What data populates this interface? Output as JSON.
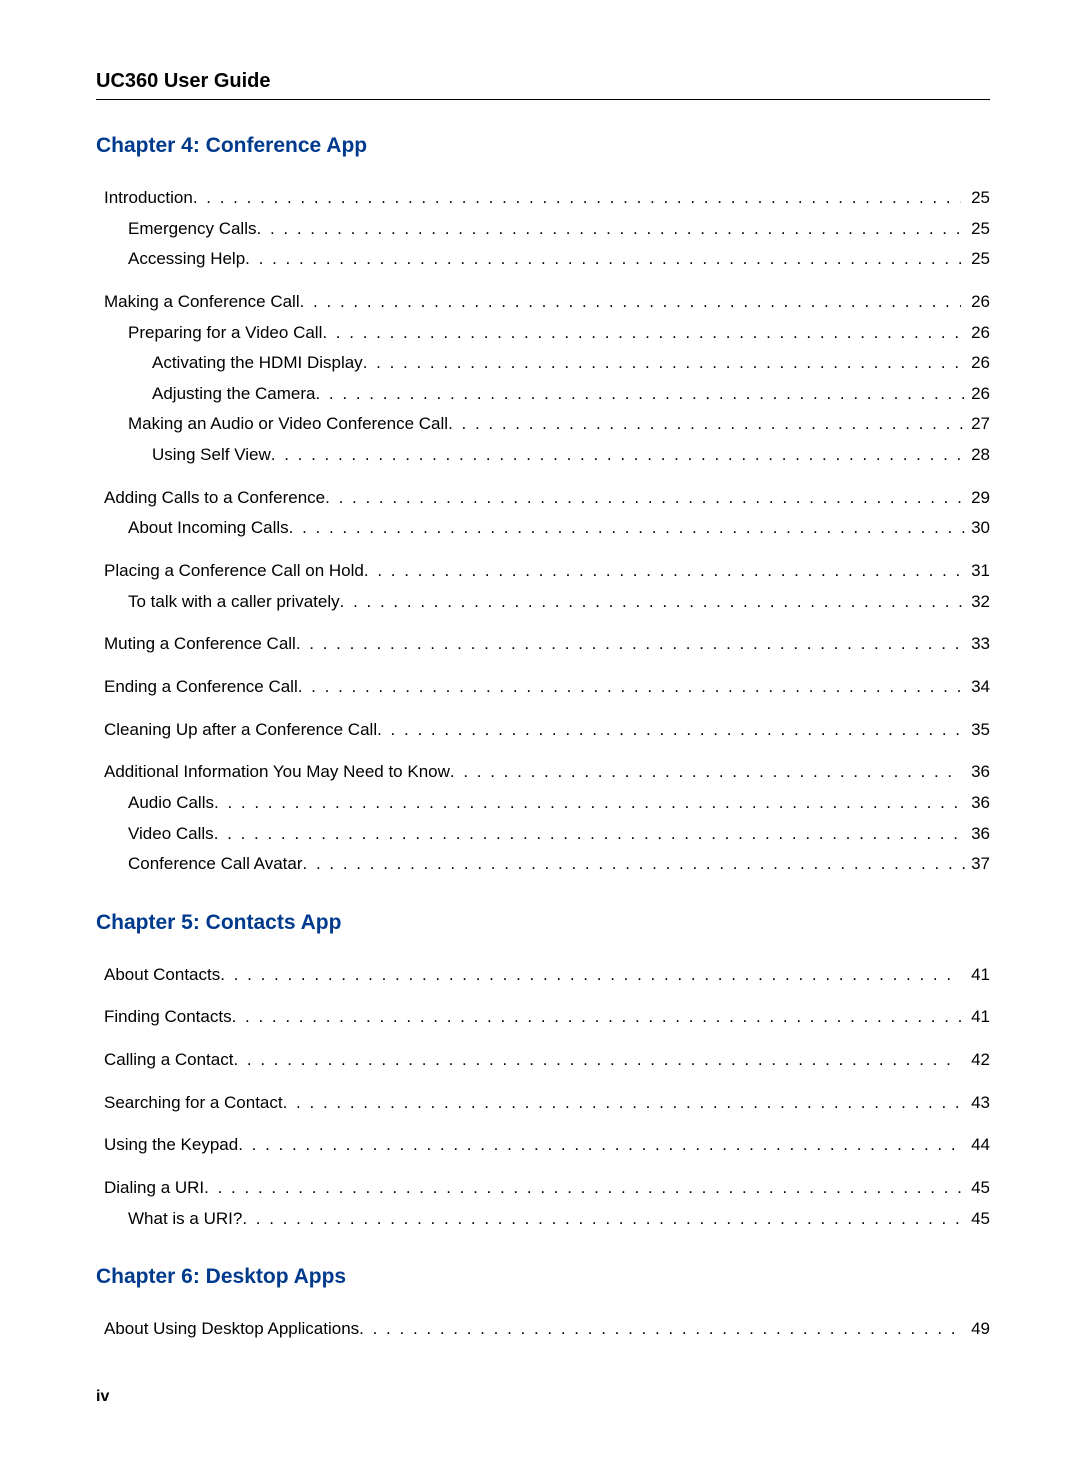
{
  "doc_title": "UC360 User Guide",
  "page_number": "iv",
  "chapters": [
    {
      "title": "Chapter 4: Conference App",
      "entries": [
        {
          "level": 0,
          "title": "Introduction",
          "page": "25",
          "first": true
        },
        {
          "level": 1,
          "title": "Emergency Calls ",
          "page": "25"
        },
        {
          "level": 1,
          "title": "Accessing Help ",
          "page": "25"
        },
        {
          "level": 0,
          "title": "Making a Conference Call",
          "page": "26"
        },
        {
          "level": 1,
          "title": "Preparing for a Video Call ",
          "page": "26"
        },
        {
          "level": 2,
          "title": "Activating the HDMI Display ",
          "page": "26"
        },
        {
          "level": 2,
          "title": "Adjusting the Camera ",
          "page": "26"
        },
        {
          "level": 1,
          "title": "Making an Audio or Video Conference Call ",
          "page": "27"
        },
        {
          "level": 2,
          "title": "Using Self View ",
          "page": "28"
        },
        {
          "level": 0,
          "title": "Adding Calls to a Conference",
          "page": "29"
        },
        {
          "level": 1,
          "title": "About Incoming Calls ",
          "page": "30"
        },
        {
          "level": 0,
          "title": "Placing a Conference Call on Hold",
          "page": "31"
        },
        {
          "level": 1,
          "title": "To talk with a caller privately ",
          "page": "32"
        },
        {
          "level": 0,
          "title": "Muting a Conference Call",
          "page": "33"
        },
        {
          "level": 0,
          "title": "Ending a Conference Call",
          "page": "34"
        },
        {
          "level": 0,
          "title": "Cleaning Up after a Conference Call ",
          "page": "35"
        },
        {
          "level": 0,
          "title": "Additional Information You May Need to Know ",
          "page": "36"
        },
        {
          "level": 1,
          "title": "Audio Calls ",
          "page": "36"
        },
        {
          "level": 1,
          "title": "Video Calls ",
          "page": "36"
        },
        {
          "level": 1,
          "title": "Conference Call Avatar ",
          "page": "37"
        }
      ]
    },
    {
      "title": "Chapter 5: Contacts App",
      "entries": [
        {
          "level": 0,
          "title": "About Contacts",
          "page": "41",
          "first": true
        },
        {
          "level": 0,
          "title": "Finding Contacts",
          "page": "41"
        },
        {
          "level": 0,
          "title": "Calling a Contact ",
          "page": "42"
        },
        {
          "level": 0,
          "title": "Searching for a Contact ",
          "page": "43"
        },
        {
          "level": 0,
          "title": "Using the Keypad",
          "page": "44"
        },
        {
          "level": 0,
          "title": "Dialing a URI",
          "page": "45"
        },
        {
          "level": 1,
          "title": "What is a URI? ",
          "page": "45"
        }
      ]
    },
    {
      "title": "Chapter 6: Desktop Apps",
      "entries": [
        {
          "level": 0,
          "title": "About Using Desktop Applications",
          "page": "49",
          "first": true
        }
      ]
    }
  ]
}
